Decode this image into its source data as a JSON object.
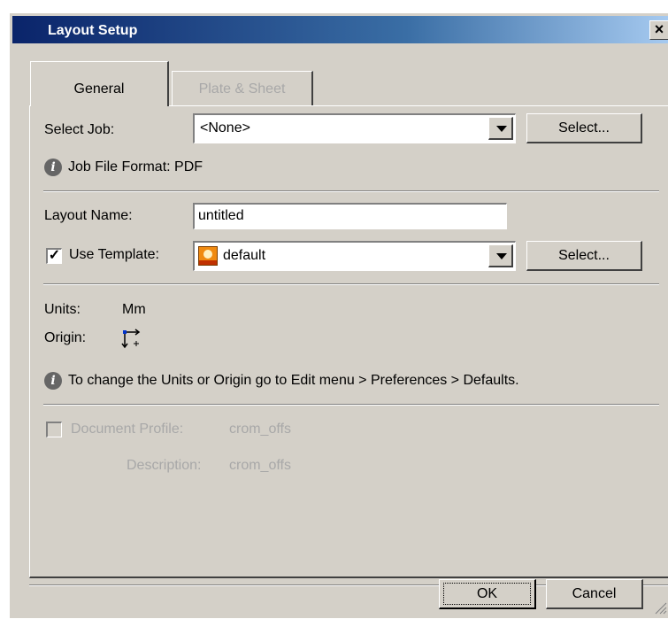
{
  "window": {
    "title": "Layout Setup",
    "close_glyph": "×"
  },
  "tabs": [
    {
      "label": "General",
      "active": true
    },
    {
      "label": "Plate & Sheet",
      "active": false
    }
  ],
  "job": {
    "label": "Select Job:",
    "value": "<None>",
    "select_button": "Select...",
    "info": "Job File Format: PDF"
  },
  "layout": {
    "name_label": "Layout Name:",
    "name_value": "untitled",
    "template_label": "Use Template:",
    "template_checked": true,
    "template_value": "default",
    "template_icon": "template-icon",
    "select_button": "Select..."
  },
  "units": {
    "units_label": "Units:",
    "units_value": "Mm",
    "origin_label": "Origin:",
    "origin_icon": "origin-icon",
    "info": "To change the Units or Origin go to Edit menu > Preferences > Defaults."
  },
  "profile": {
    "label": "Document Profile:",
    "value": "crom_offs",
    "description_label": "Description:",
    "description_value": "crom_offs",
    "checked": false,
    "enabled": false
  },
  "footer": {
    "ok": "OK",
    "cancel": "Cancel"
  },
  "colors": {
    "dialog_bg": "#d4d0c8",
    "title_start": "#0a246a",
    "title_end": "#a6caf0",
    "disabled_text": "#a8a8a8"
  }
}
